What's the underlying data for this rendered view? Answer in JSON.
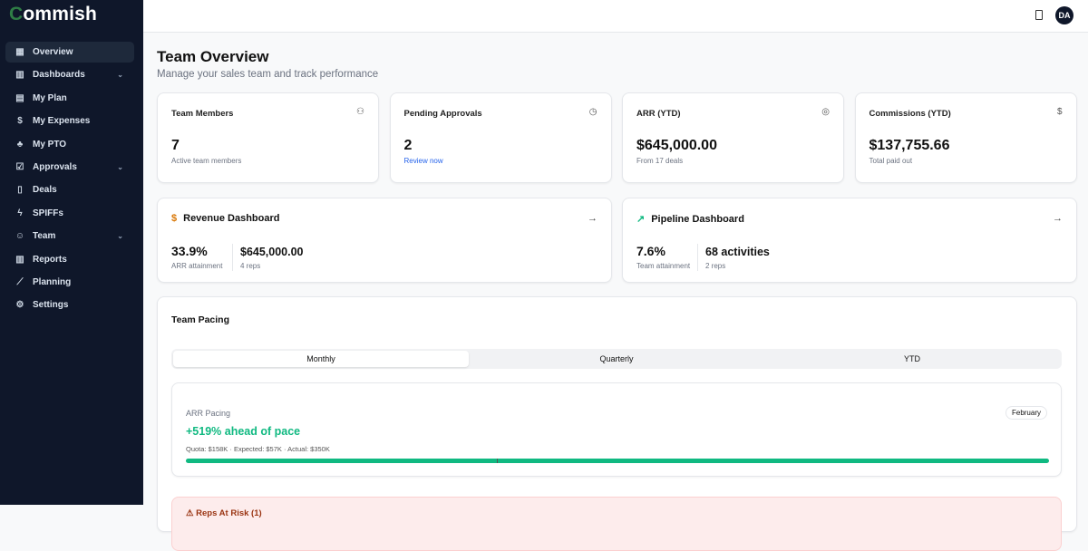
{
  "app": {
    "logo": "Commish",
    "logo_first": "C",
    "logo_rest": "ommish"
  },
  "sidebar": {
    "items": [
      {
        "label": "Overview",
        "icon": "grid-icon",
        "glyph": "▦",
        "active": true
      },
      {
        "label": "Dashboards",
        "icon": "bar-chart-icon",
        "glyph": "▥",
        "chevron": true
      },
      {
        "label": "My Plan",
        "icon": "calculator-icon",
        "glyph": "▤"
      },
      {
        "label": "My Expenses",
        "icon": "receipt-dollar-icon",
        "glyph": "$"
      },
      {
        "label": "My PTO",
        "icon": "palm-tree-icon",
        "glyph": "♣"
      },
      {
        "label": "Approvals",
        "icon": "check-square-icon",
        "glyph": "☑",
        "chevron": true
      },
      {
        "label": "Deals",
        "icon": "file-icon",
        "glyph": "▯"
      },
      {
        "label": "SPIFFs",
        "icon": "zap-icon",
        "glyph": "ϟ"
      },
      {
        "label": "Team",
        "icon": "users-icon",
        "glyph": "☺",
        "chevron": true
      },
      {
        "label": "Reports",
        "icon": "bar-chart-icon",
        "glyph": "▥"
      },
      {
        "label": "Planning",
        "icon": "line-chart-icon",
        "glyph": "⟋"
      },
      {
        "label": "Settings",
        "icon": "gear-icon",
        "glyph": "⚙"
      }
    ]
  },
  "topbar": {
    "avatar": "DA"
  },
  "header": {
    "title": "Team Overview",
    "subtitle": "Manage your sales team and track performance"
  },
  "stats": [
    {
      "title": "Team Members",
      "value": "7",
      "sub": "Active team members",
      "icon": "users-icon",
      "glyph": "⚇"
    },
    {
      "title": "Pending Approvals",
      "value": "2",
      "sub": "Review now",
      "icon": "clock-icon",
      "glyph": "◷"
    },
    {
      "title": "ARR (YTD)",
      "value": "$645,000.00",
      "sub": "From 17 deals",
      "icon": "target-icon",
      "glyph": "◎"
    },
    {
      "title": "Commissions (YTD)",
      "value": "$137,755.66",
      "sub": "Total paid out",
      "icon": "dollar-icon",
      "glyph": "$"
    }
  ],
  "dashboards": [
    {
      "title": "Revenue Dashboard",
      "glyph": "$",
      "color": "#d97706",
      "m1": "33.9%",
      "m1_label": "ARR attainment",
      "m2": "$645,000.00",
      "m2_label": "4 reps"
    },
    {
      "title": "Pipeline Dashboard",
      "glyph": "↗",
      "color": "#10b981",
      "m1": "7.6%",
      "m1_label": "Team attainment",
      "m2": "68 activities",
      "m2_label": "2 reps"
    }
  ],
  "pacing": {
    "title": "Team Pacing",
    "tabs": [
      "Monthly",
      "Quarterly",
      "YTD"
    ],
    "active_tab": "Monthly",
    "arr": {
      "label": "ARR Pacing",
      "badge": "February",
      "headline": "+519% ahead of pace",
      "detail": "Quota: $158K · Expected: $57K · Actual: $350K",
      "progress_pct": 100,
      "expected_pct": 36
    },
    "risk": "⚠ Reps At Risk (1)"
  },
  "colors": {
    "sidebar": "#0f172a",
    "green": "#10b981",
    "link": "#2563eb"
  }
}
